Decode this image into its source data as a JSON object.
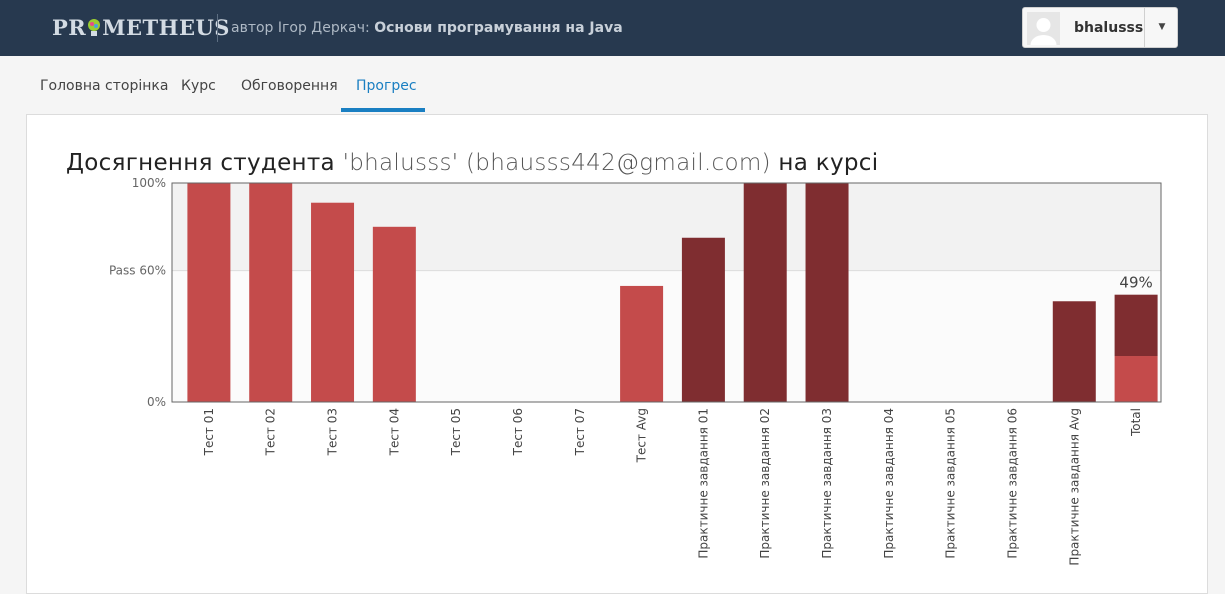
{
  "header": {
    "logo_text_left": "PR",
    "logo_text_right": "METHEUS",
    "course_prefix": "автор Ігор Деркач:",
    "course_title": "Основи програмування на Java",
    "username": "bhalusss",
    "dropdown_icon": "caret-down-icon"
  },
  "nav": {
    "tabs": [
      {
        "label": "Головна сторінка",
        "active": false
      },
      {
        "label": "Курс",
        "active": false
      },
      {
        "label": "Обговорення",
        "active": false
      },
      {
        "label": "Прогрес",
        "active": true
      }
    ]
  },
  "page": {
    "title_prefix": "Досягнення студента",
    "title_name": "'bhalusss' (bhausss442@gmail.com)",
    "title_suffix": "на курсі"
  },
  "colors": {
    "header_bg": "#27394f",
    "tab_active": "#1a7fc2",
    "bar_test": "#c44b4b",
    "bar_practical": "#7f2d30",
    "fail_band": "#fbfbfb",
    "pass_band": "#f2f2f2"
  },
  "chart_data": {
    "type": "bar",
    "ylim": [
      0,
      100
    ],
    "ytick_labels": [
      "100%",
      "Pass 60%",
      "0%"
    ],
    "pass_threshold": 60,
    "categories": [
      "Тест 01",
      "Тест 02",
      "Тест 03",
      "Тест 04",
      "Тест 05",
      "Тест 06",
      "Тест 07",
      "Тест Avg",
      "Практичне завдання 01",
      "Практичне завдання 02",
      "Практичне завдання 03",
      "Практичне завдання 04",
      "Практичне завдання 05",
      "Практичне завдання 06",
      "Практичне завдання Avg",
      "Total"
    ],
    "series": [
      {
        "values": [
          100,
          100,
          91,
          80,
          0,
          0,
          0,
          53,
          0,
          0,
          0,
          0,
          0,
          0,
          0,
          21
        ]
      },
      {
        "values": [
          0,
          0,
          0,
          0,
          0,
          0,
          0,
          0,
          75,
          100,
          100,
          0,
          0,
          0,
          46,
          28
        ]
      }
    ],
    "total_label": "49%"
  }
}
